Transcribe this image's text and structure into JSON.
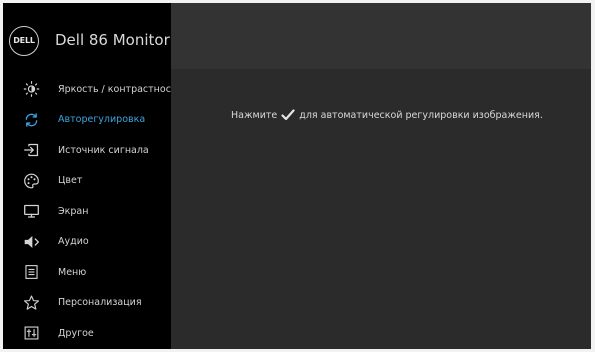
{
  "app": {
    "brand": "DELL",
    "title": "Dell 86 Monitor"
  },
  "menu": [
    {
      "id": "brightness",
      "label": "Яркость / контрастность",
      "icon": "brightness-icon",
      "active": false
    },
    {
      "id": "auto-adjust",
      "label": "Авторегулировка",
      "icon": "auto-adjust-icon",
      "active": true
    },
    {
      "id": "input-source",
      "label": "Источник сигнала",
      "icon": "input-source-icon",
      "active": false
    },
    {
      "id": "color",
      "label": "Цвет",
      "icon": "color-palette-icon",
      "active": false
    },
    {
      "id": "display",
      "label": "Экран",
      "icon": "display-icon",
      "active": false
    },
    {
      "id": "audio",
      "label": "Аудио",
      "icon": "speaker-icon",
      "active": false
    },
    {
      "id": "menu",
      "label": "Меню",
      "icon": "menu-icon",
      "active": false
    },
    {
      "id": "personalize",
      "label": "Персонализация",
      "icon": "star-icon",
      "active": false
    },
    {
      "id": "others",
      "label": "Другое",
      "icon": "others-icon",
      "active": false
    }
  ],
  "main": {
    "instruction_before": "Нажмите",
    "instruction_icon": "checkmark-icon",
    "instruction_after": "для автоматической регулировки изображения."
  },
  "colors": {
    "accent": "#3fa3de",
    "sidebar_bg": "#000000",
    "main_bg": "#2b2b2b"
  }
}
